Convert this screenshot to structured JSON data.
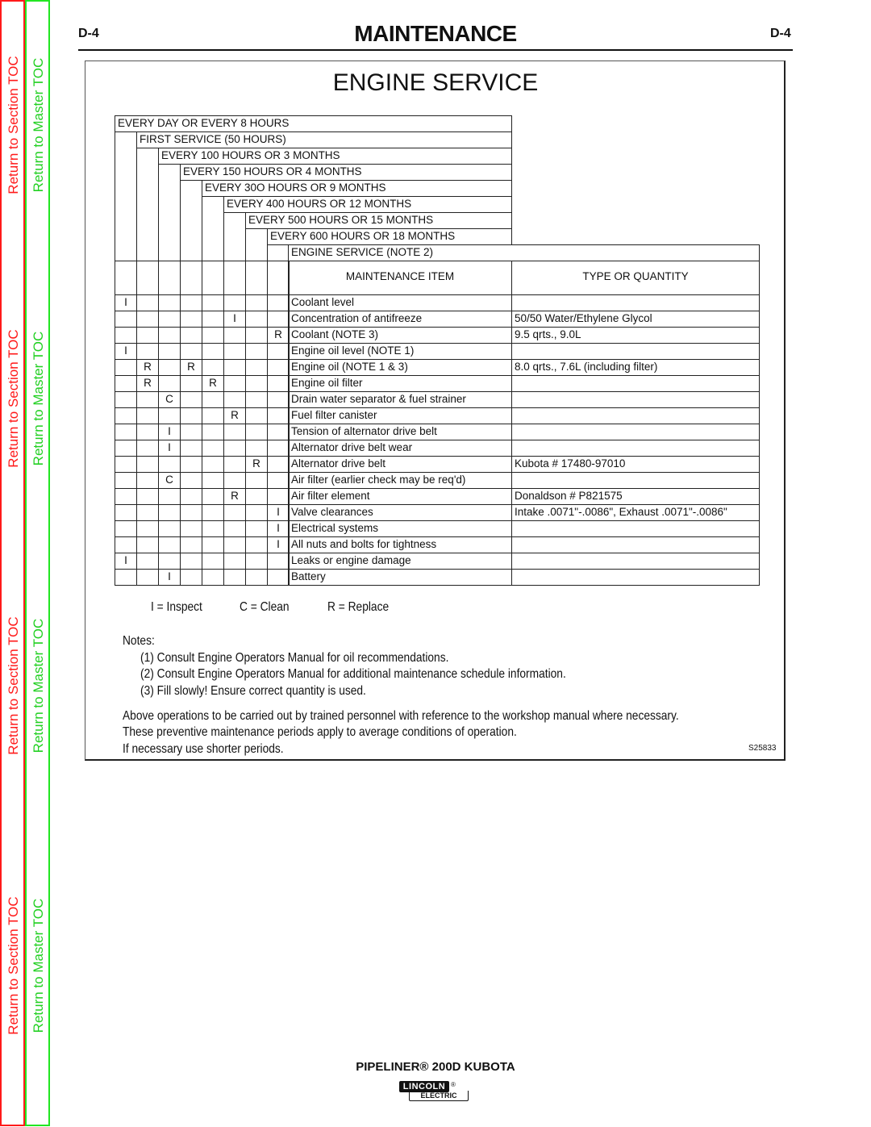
{
  "toc": {
    "section_label": "Return to Section TOC",
    "master_label": "Return to Master TOC",
    "colors": {
      "section": "#ff1a1a",
      "master": "#22d022"
    }
  },
  "header": {
    "page_left": "D-4",
    "page_right": "D-4",
    "title": "MAINTENANCE"
  },
  "section_title": "ENGINE SERVICE",
  "schedule": {
    "intervals": [
      "EVERY DAY OR EVERY 8 HOURS",
      "FIRST SERVICE (50 HOURS)",
      "EVERY 100 HOURS OR 3 MONTHS",
      "EVERY 150 HOURS OR 4 MONTHS",
      "EVERY 30O HOURS OR 9 MONTHS",
      "EVERY 400 HOURS OR 12 MONTHS",
      "EVERY 500 HOURS OR 15 MONTHS",
      "EVERY 600 HOURS OR 18 MONTHS",
      "ENGINE SERVICE (NOTE 2)"
    ],
    "col_headers": {
      "item": "MAINTENANCE ITEM",
      "type": "TYPE OR QUANTITY"
    },
    "rows": [
      {
        "marks": [
          "I",
          "",
          "",
          "",
          "",
          "",
          "",
          "",
          ""
        ],
        "item": "Coolant level",
        "type": ""
      },
      {
        "marks": [
          "",
          "",
          "",
          "",
          "",
          "I",
          "",
          "",
          ""
        ],
        "item": "Concentration of antifreeze",
        "type": "50/50 Water/Ethylene Glycol"
      },
      {
        "marks": [
          "",
          "",
          "",
          "",
          "",
          "",
          "",
          "R",
          ""
        ],
        "item": "Coolant (NOTE 3)",
        "type": "9.5 qrts., 9.0L"
      },
      {
        "marks": [
          "I",
          "",
          "",
          "",
          "",
          "",
          "",
          "",
          ""
        ],
        "item": "Engine oil level (NOTE 1)",
        "type": ""
      },
      {
        "marks": [
          "",
          "R",
          "",
          "R",
          "",
          "",
          "",
          "",
          ""
        ],
        "item": "Engine oil (NOTE 1 & 3)",
        "type": "8.0 qrts., 7.6L (including filter)"
      },
      {
        "marks": [
          "",
          "R",
          "",
          "",
          "R",
          "",
          "",
          "",
          ""
        ],
        "item": "Engine oil filter",
        "type": ""
      },
      {
        "marks": [
          "",
          "",
          "C",
          "",
          "",
          "",
          "",
          "",
          ""
        ],
        "item": "Drain water separator & fuel strainer",
        "type": ""
      },
      {
        "marks": [
          "",
          "",
          "",
          "",
          "",
          "R",
          "",
          "",
          ""
        ],
        "item": "Fuel filter canister",
        "type": ""
      },
      {
        "marks": [
          "",
          "",
          "I",
          "",
          "",
          "",
          "",
          "",
          ""
        ],
        "item": "Tension of alternator drive belt",
        "type": ""
      },
      {
        "marks": [
          "",
          "",
          "I",
          "",
          "",
          "",
          "",
          "",
          ""
        ],
        "item": "Alternator drive belt wear",
        "type": ""
      },
      {
        "marks": [
          "",
          "",
          "",
          "",
          "",
          "",
          "R",
          "",
          ""
        ],
        "item": "Alternator drive belt",
        "type": "Kubota # 17480-97010"
      },
      {
        "marks": [
          "",
          "",
          "C",
          "",
          "",
          "",
          "",
          "",
          ""
        ],
        "item": "Air filter (earlier check may be req'd)",
        "type": ""
      },
      {
        "marks": [
          "",
          "",
          "",
          "",
          "",
          "R",
          "",
          "",
          ""
        ],
        "item": "Air filter element",
        "type": "Donaldson # P821575"
      },
      {
        "marks": [
          "",
          "",
          "",
          "",
          "",
          "",
          "",
          "I",
          ""
        ],
        "item": "Valve clearances",
        "type": "Intake .0071\"-.0086\", Exhaust .0071\"-.0086\""
      },
      {
        "marks": [
          "",
          "",
          "",
          "",
          "",
          "",
          "",
          "I",
          ""
        ],
        "item": "Electrical systems",
        "type": ""
      },
      {
        "marks": [
          "",
          "",
          "",
          "",
          "",
          "",
          "",
          "I",
          ""
        ],
        "item": "All nuts and bolts for tightness",
        "type": ""
      },
      {
        "marks": [
          "I",
          "",
          "",
          "",
          "",
          "",
          "",
          "",
          ""
        ],
        "item": "Leaks or engine damage",
        "type": ""
      },
      {
        "marks": [
          "",
          "",
          "I",
          "",
          "",
          "",
          "",
          "",
          ""
        ],
        "item": "Battery",
        "type": ""
      }
    ]
  },
  "legend": {
    "inspect": "I = Inspect",
    "clean": "C = Clean",
    "replace": "R = Replace"
  },
  "notes": {
    "heading": "Notes:",
    "items": [
      "(1) Consult Engine Operators Manual for oil recommendations.",
      "(2) Consult Engine Operators Manual for additional maintenance schedule information.",
      "(3) Fill slowly! Ensure correct quantity is used."
    ]
  },
  "disclaimer": [
    "Above operations to be carried out by trained personnel with reference to the workshop manual where necessary.",
    "These preventive maintenance periods apply to average conditions of operation.",
    "If necessary use shorter periods."
  ],
  "figure_code": "S25833",
  "footer": {
    "product": "PIPELINER® 200D KUBOTA",
    "logo_top": "LINCOLN",
    "logo_reg": "®",
    "logo_bottom": "ELECTRIC"
  }
}
